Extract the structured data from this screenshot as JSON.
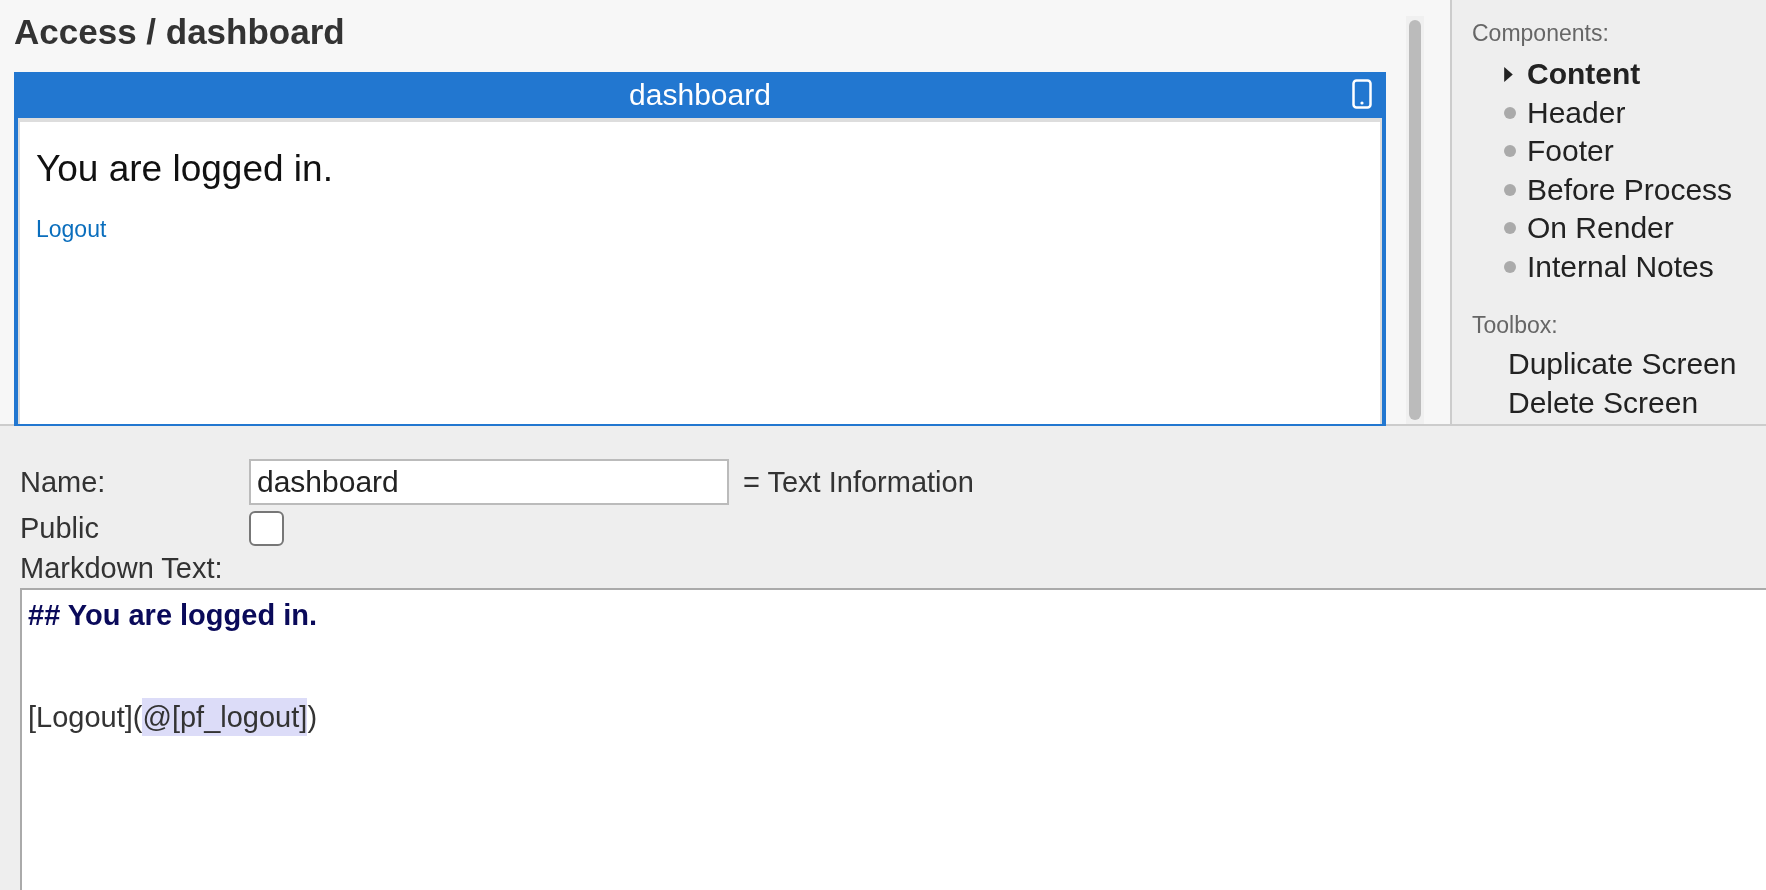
{
  "page_title": "Access / dashboard",
  "preview": {
    "title": "dashboard",
    "heading": "You are logged in.",
    "link": "Logout"
  },
  "sidebar": {
    "components_label": "Components:",
    "items": [
      {
        "label": "Content",
        "selected": true
      },
      {
        "label": "Header",
        "selected": false
      },
      {
        "label": "Footer",
        "selected": false
      },
      {
        "label": "Before Process",
        "selected": false
      },
      {
        "label": "On Render",
        "selected": false
      },
      {
        "label": "Internal Notes",
        "selected": false
      }
    ],
    "toolbox_label": "Toolbox:",
    "toolbox": [
      "Duplicate Screen",
      "Delete Screen"
    ]
  },
  "form": {
    "name_label": "Name:",
    "name_value": "dashboard",
    "type_info": "= Text Information",
    "public_label": "Public",
    "public_checked": false,
    "markdown_label": "Markdown Text:",
    "markdown_lines": [
      {
        "kind": "heading",
        "segments": [
          {
            "text": "## You are logged in.",
            "highlighted": false
          }
        ]
      },
      {
        "kind": "blank"
      },
      {
        "kind": "text",
        "segments": [
          {
            "text": "[Logout](",
            "highlighted": false
          },
          {
            "text": "@[pf_logout]",
            "highlighted": true
          },
          {
            "text": ")",
            "highlighted": false
          }
        ]
      }
    ]
  }
}
